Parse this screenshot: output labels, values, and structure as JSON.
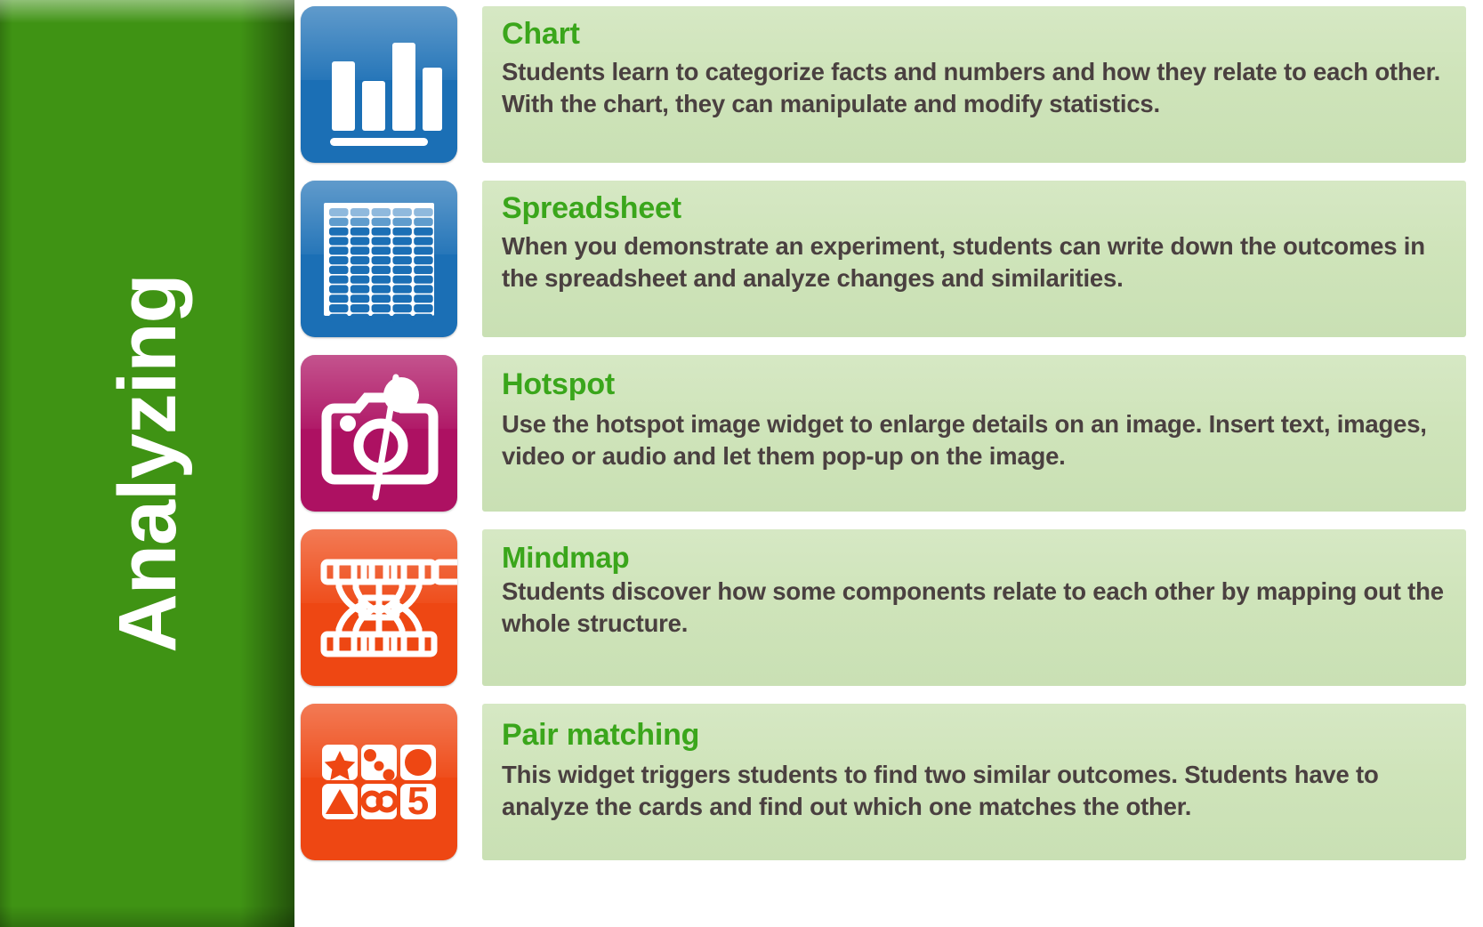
{
  "category": {
    "label": "Analyzing",
    "background_color": "#3f9314",
    "text_color": "#ffffff"
  },
  "colors": {
    "title_green": "#3aa61b",
    "body_text": "#4a4040",
    "card_green": "#cfe4ba",
    "tile_blue": "#1b6fb5",
    "tile_magenta": "#ad1162",
    "tile_orange": "#ee4713"
  },
  "rows": [
    {
      "icon": "bar-chart-icon",
      "tile_color": "#1b6fb5",
      "title": "Chart",
      "body": "Students learn to categorize facts and numbers and how they relate to each other. With the chart, they can manipulate and modify statistics."
    },
    {
      "icon": "spreadsheet-grid-icon",
      "tile_color": "#1b6fb5",
      "title": "Spreadsheet",
      "body": "When you demonstrate an experiment, students can write down the outcomes in the spreadsheet and analyze changes and similarities."
    },
    {
      "icon": "hotspot-camera-pin-icon",
      "tile_color": "#ad1162",
      "title": "Hotspot",
      "body": "Use the hotspot image widget to enlarge details on an image. Insert text, images, video or audio and let them pop-up on the image."
    },
    {
      "icon": "mindmap-nodes-icon",
      "tile_color": "#ee4713",
      "title": "Mindmap",
      "body": "Students discover how some components relate to each other by mapping out the whole structure."
    },
    {
      "icon": "pair-matching-cards-icon",
      "tile_color": "#ee4713",
      "title": "Pair matching",
      "body": "This widget triggers students to find two similar outcomes. Students have to analyze the cards and find out which one matches the other.",
      "card_symbols": [
        "star",
        "dots",
        "circle",
        "triangle",
        "infinity",
        "5"
      ]
    }
  ]
}
